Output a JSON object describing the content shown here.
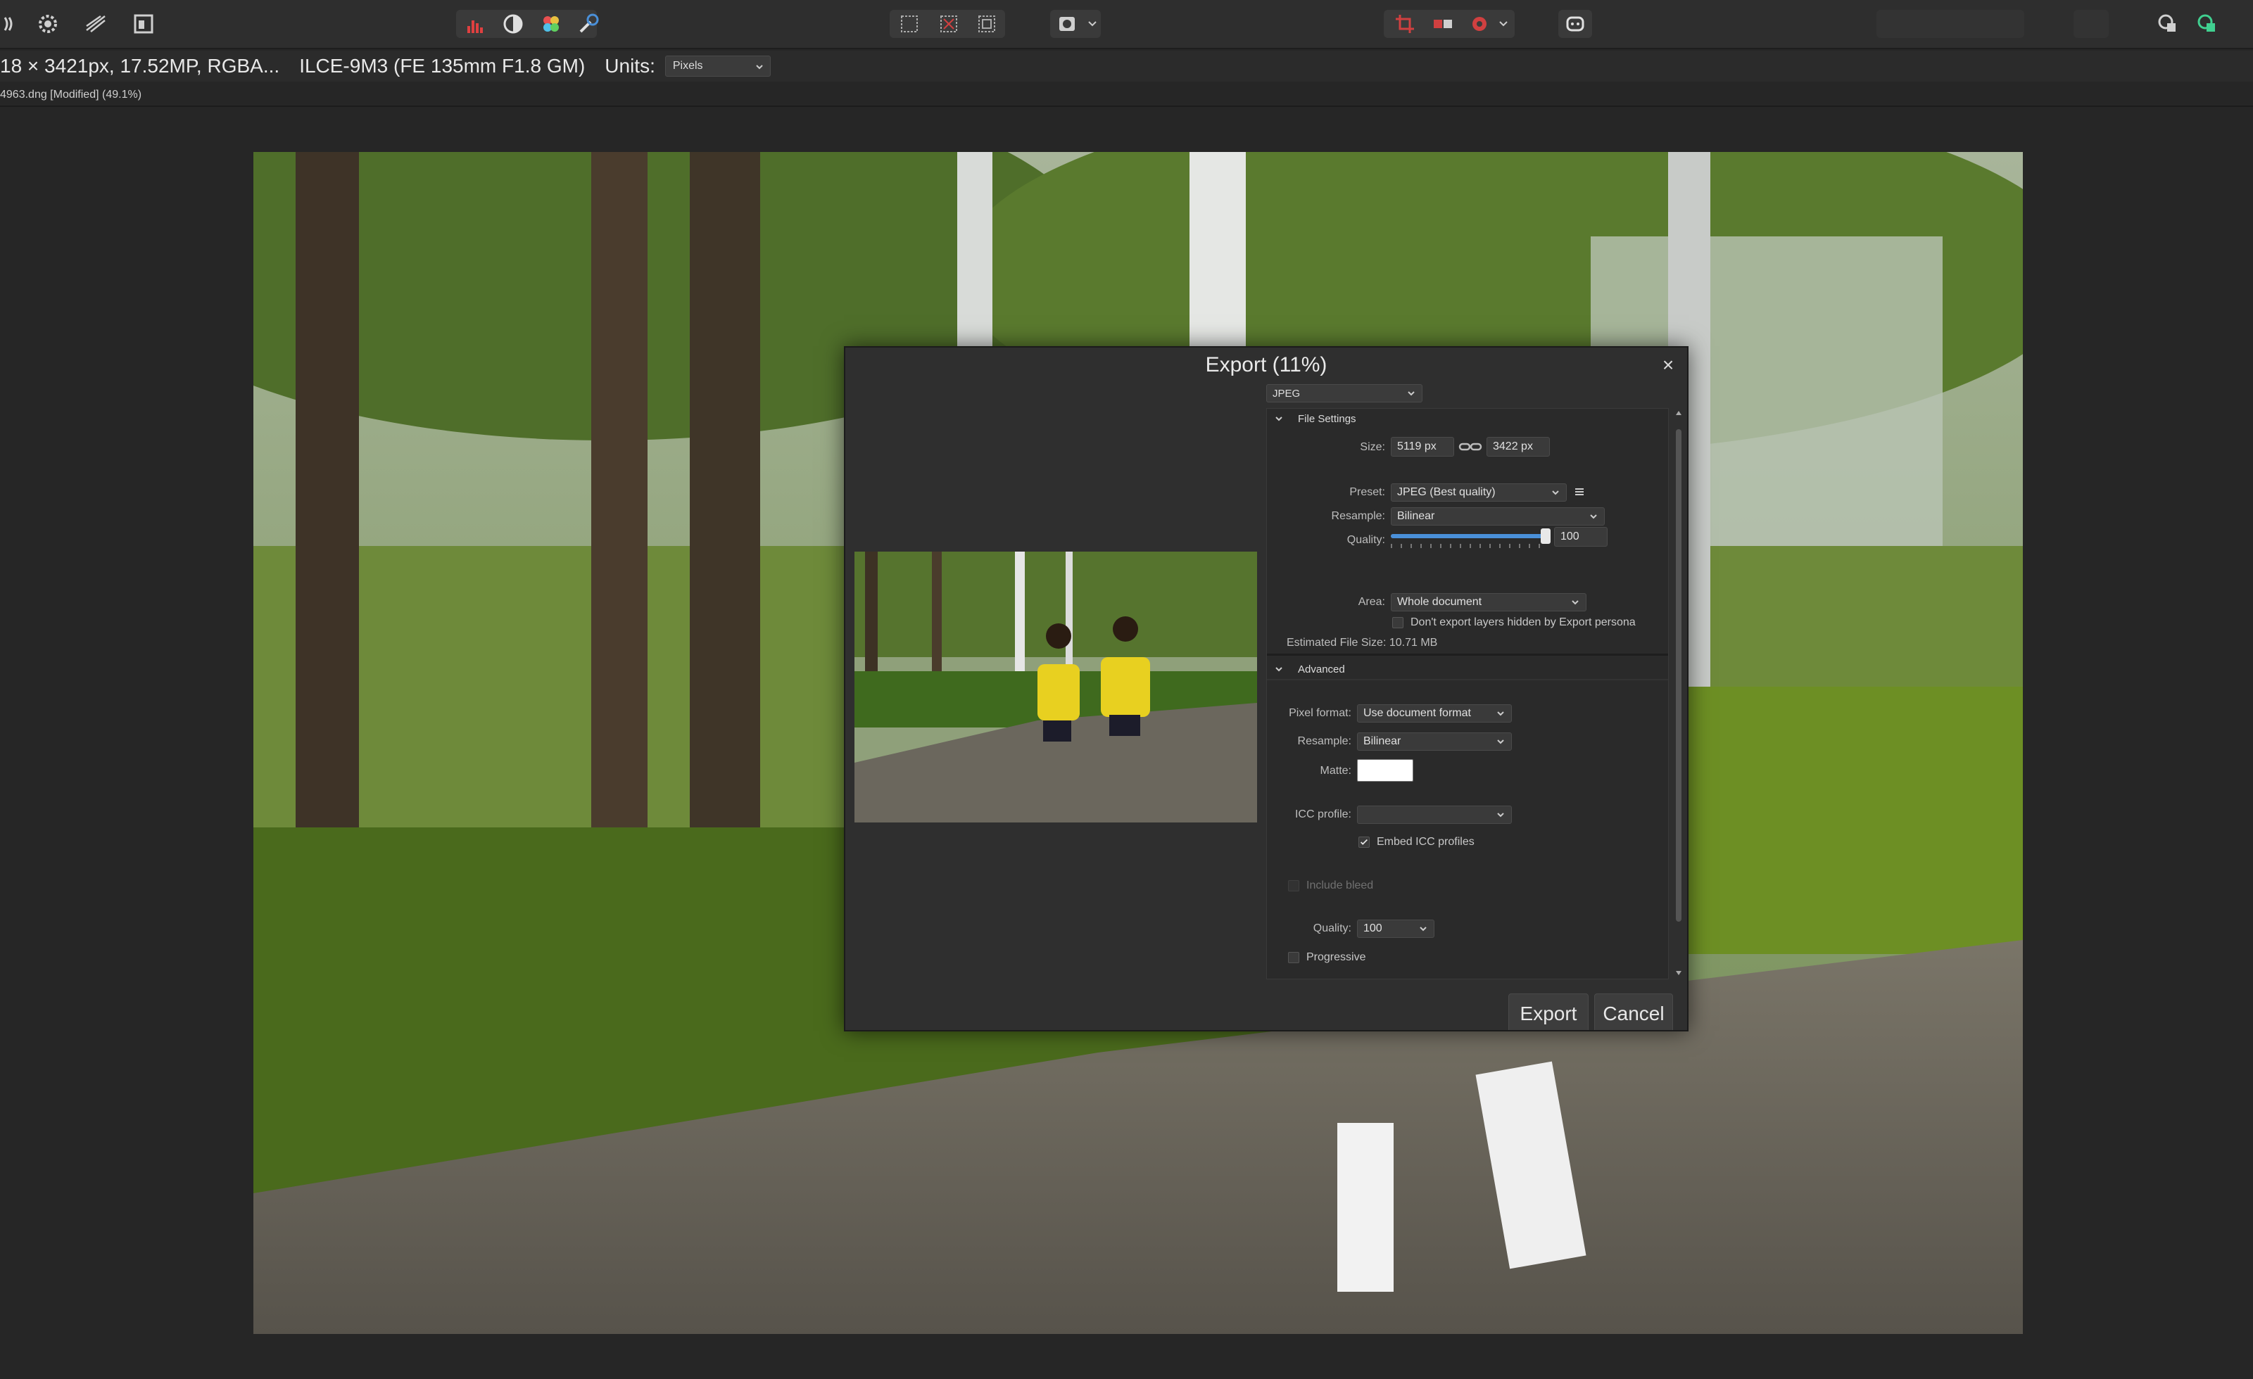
{
  "toolbar": {
    "icons": [
      "persona-icon",
      "settings-gear-icon",
      "curves-icon",
      "export-persona-icon",
      "histogram-icon",
      "brush-mask-icon",
      "color-wheel-icon",
      "selection-brush-icon",
      "marquee-icon",
      "marquee-subtract-icon",
      "marquee-invert-icon",
      "quick-mask-icon",
      "crop-icon",
      "mirror-icon",
      "record-icon",
      "assistant-icon",
      "studio-panel-icon",
      "studio-panel-2-icon"
    ]
  },
  "context_bar": {
    "dimensions": "18 × 3421px, 17.52MP, RGBA...",
    "camera": "ILCE-9M3 (FE 135mm F1.8 GM)",
    "units_label": "Units:",
    "units_value": "Pixels"
  },
  "document_tab": {
    "title": "4963.dng [Modified] (49.1%)"
  },
  "dialog": {
    "title": "Export (11%)",
    "close_glyph": "×",
    "format": "JPEG",
    "file_settings": {
      "header": "File Settings",
      "size_label": "Size:",
      "width": "5119 px",
      "height": "3422 px",
      "preset_label": "Preset:",
      "preset_value": "JPEG (Best quality)",
      "resample_label": "Resample:",
      "resample_value": "Bilinear",
      "quality_label": "Quality:",
      "quality_value": "100",
      "quality_fraction": 1.0,
      "area_label": "Area:",
      "area_value": "Whole document",
      "hidden_layers_label": "Don't export layers hidden by Export persona",
      "estimated_size": "Estimated File Size: 10.71 MB"
    },
    "advanced": {
      "header": "Advanced",
      "pixel_format_label": "Pixel format:",
      "pixel_format_value": "Use document format",
      "resample_label": "Resample:",
      "resample_value": "Bilinear",
      "matte_label": "Matte:",
      "matte_color": "#ffffff",
      "icc_label": "ICC profile:",
      "icc_value": "",
      "embed_icc_label": "Embed ICC profiles",
      "embed_icc_checked": true,
      "include_bleed_label": "Include bleed",
      "quality_label": "Quality:",
      "quality_value": "100",
      "progressive_label": "Progressive"
    },
    "buttons": {
      "export": "Export",
      "cancel": "Cancel"
    }
  },
  "colors": {
    "accent": "#4a90d9",
    "background": "#262626",
    "panel": "#2f2f2f"
  }
}
